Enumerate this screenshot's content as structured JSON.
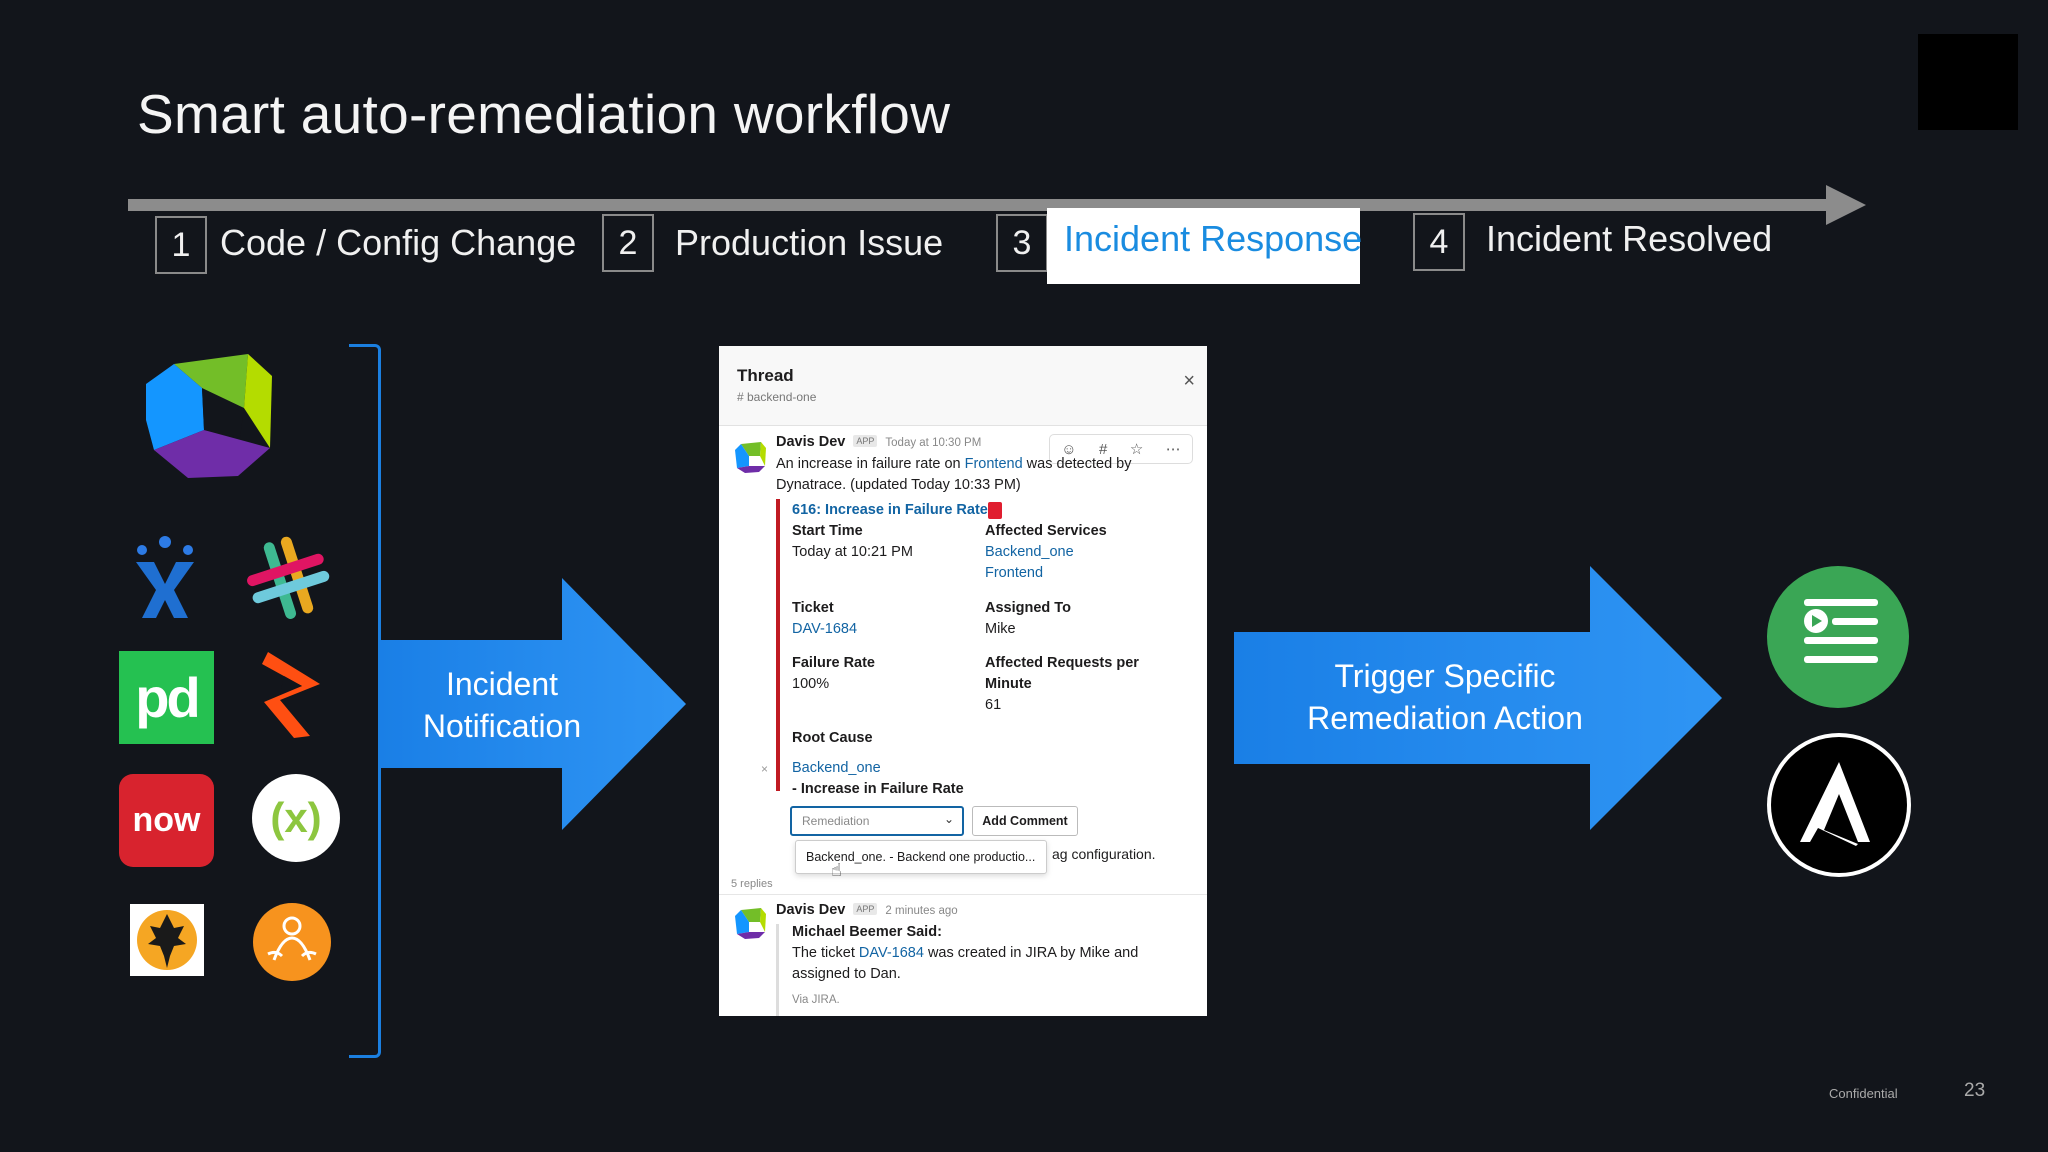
{
  "slide": {
    "title": "Smart auto-remediation workflow",
    "page_number": "23",
    "confidential": "Confidential"
  },
  "timeline": {
    "steps": [
      {
        "number": "1",
        "label": "Code / Config Change",
        "active": false
      },
      {
        "number": "2",
        "label": "Production Issue",
        "active": false
      },
      {
        "number": "3",
        "label": "Incident Response",
        "active": true
      },
      {
        "number": "4",
        "label": "Incident Resolved",
        "active": false
      }
    ]
  },
  "logos": [
    "dynatrace-logo",
    "jira-logo",
    "slack-logo",
    "pagerduty-logo",
    "opsgenie-logo",
    "servicenow-logo",
    "xmatters-logo",
    "victorops-logo",
    "zen-logo",
    "stackstorm-logo",
    "ansible-logo"
  ],
  "logo_text": {
    "pagerduty": "pd",
    "servicenow": "now",
    "xmatters": "(x)"
  },
  "arrows": {
    "left": [
      "Incident",
      "Notification"
    ],
    "right": [
      "Trigger Specific",
      "Remediation Action"
    ]
  },
  "thread": {
    "title": "Thread",
    "channel": "# backend-one",
    "close": "×",
    "message1": {
      "author": "Davis Dev",
      "tag": "APP",
      "time": "Today at 10:30 PM",
      "line1_pre": "An increase in failure rate on ",
      "line1_link": "Frontend",
      "line1_post": " was detected by",
      "line2": "Dynatrace. (updated Today 10:33 PM)",
      "problem_link": "616: Increase in Failure Rate",
      "start_time_label": "Start Time",
      "start_time_value": "Today at 10:21 PM",
      "affected_services_label": "Affected Services",
      "affected_services": [
        "Backend_one",
        "Frontend"
      ],
      "ticket_label": "Ticket",
      "ticket_value": "DAV-1684",
      "assigned_label": "Assigned To",
      "assigned_value": "Mike",
      "failure_rate_label": "Failure Rate",
      "failure_rate_value": "100%",
      "affected_requests_label_1": "Affected Requests per",
      "affected_requests_label_2": "Minute",
      "affected_requests_value": "61",
      "root_cause_label": "Root Cause",
      "root_cause_link": "Backend_one",
      "root_cause_detail": "- Increase in Failure Rate",
      "remediation_placeholder": "Remediation",
      "add_comment": "Add Comment",
      "dropdown_option": "Backend_one. - Backend one productio...",
      "trailing_text": "ag configuration."
    },
    "replies": "5 replies",
    "message2": {
      "author": "Davis Dev",
      "tag": "APP",
      "time": "2 minutes ago",
      "line1": "Michael Beemer Said:",
      "line2_pre": "The ticket ",
      "line2_link": "DAV-1684",
      "line2_post": " was created in JIRA by Mike and",
      "line3": "assigned to Dan.",
      "via": "Via JIRA."
    }
  },
  "colors": {
    "background": "#12151b",
    "accent_blue": "#1a8ce0",
    "slack_link": "#1264a3",
    "alert_red": "#c01a22"
  }
}
